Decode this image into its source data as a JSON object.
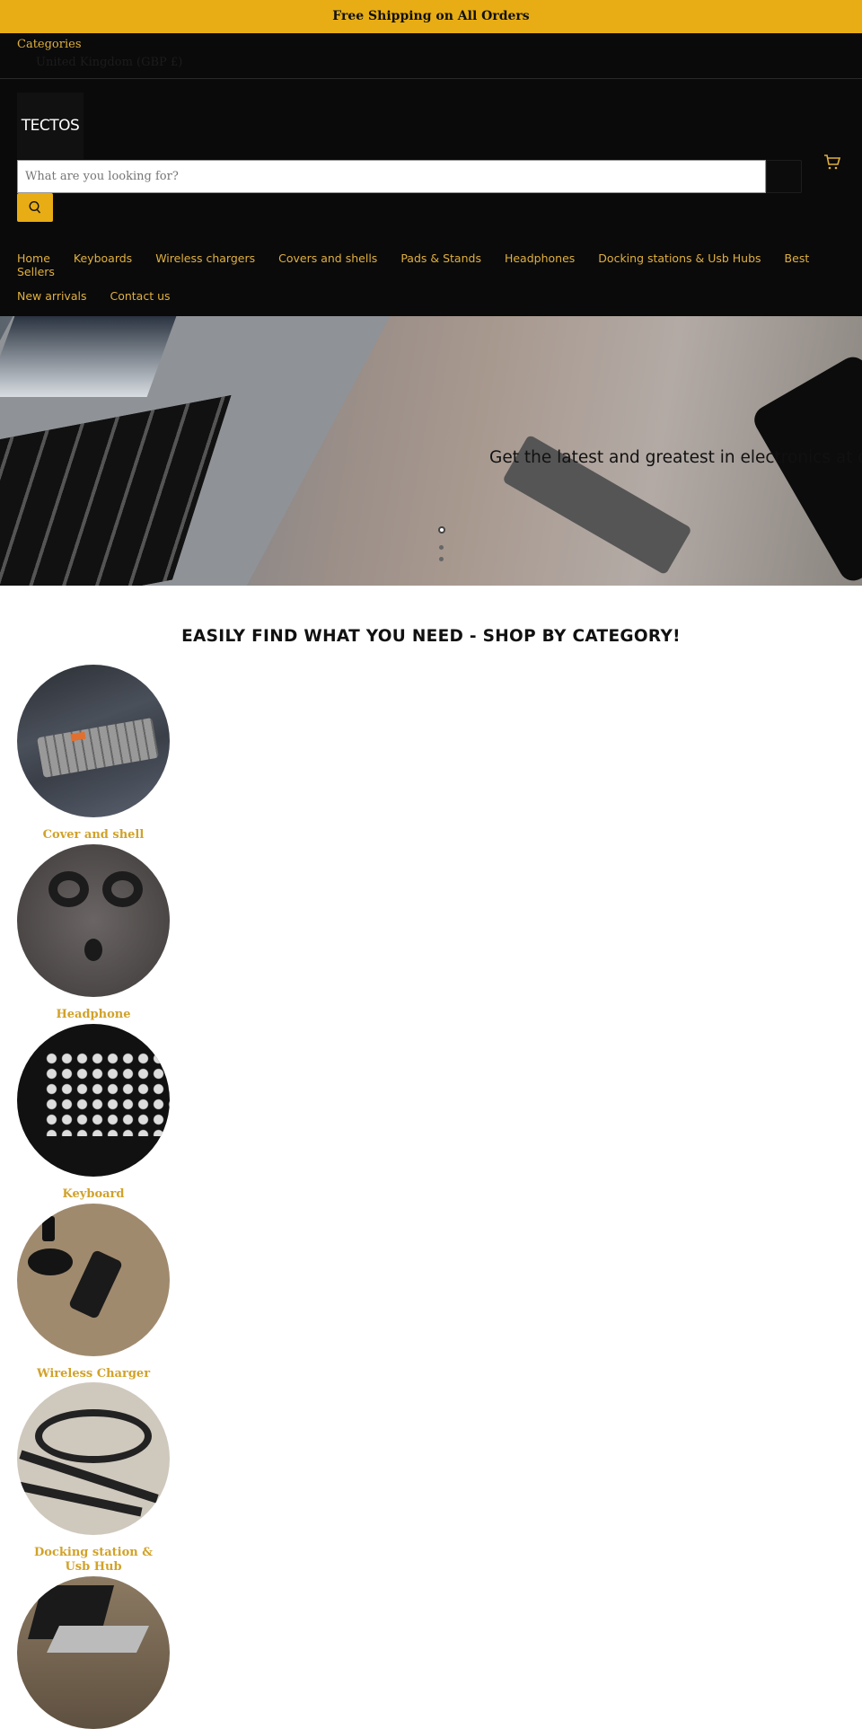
{
  "announcement": "Free Shipping on All Orders",
  "header": {
    "categories_label": "Categories",
    "currency": "United Kingdom (GBP £)",
    "logo_text": "TECTOS",
    "search_placeholder": "What are you looking for?",
    "nav_row1": [
      "Home",
      "Keyboards",
      "Wireless chargers",
      "Covers and shells",
      "Pads & Stands",
      "Headphones",
      "Docking stations & Usb Hubs",
      "Best Sellers"
    ],
    "nav_row2": [
      "New arrivals",
      "Contact us"
    ]
  },
  "hero": {
    "text": "Get the latest and greatest in electronics at our store",
    "slides": 3,
    "active_slide": 1
  },
  "categories_section": {
    "heading": "EASILY FIND WHAT YOU NEED - SHOP BY CATEGORY!",
    "items": [
      {
        "label": "Cover and shell"
      },
      {
        "label": "Headphone"
      },
      {
        "label": "Keyboard"
      },
      {
        "label": "Wireless Charger"
      },
      {
        "label": "Docking station & Usb Hub"
      },
      {
        "label": ""
      }
    ]
  },
  "colors": {
    "accent": "#e8ad14",
    "header_bg": "#0a0a0a",
    "nav_text": "#e0b040",
    "category_label": "#d1a22a"
  }
}
